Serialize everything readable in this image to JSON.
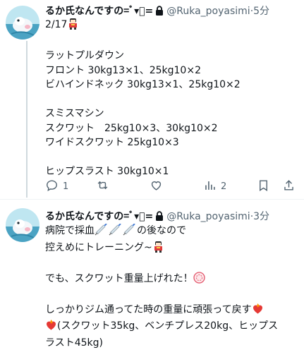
{
  "tweets": [
    {
      "author_name": "るか氏なんですの=ﾞ▾ﾞ=",
      "handle": "@Ruka_poyasimi",
      "separator": "·",
      "time": "5分",
      "body_lines": [
        "2/17",
        "",
        "ラットプルダウン",
        "フロント 30kg13×1、25kg10×2",
        "ビハインドネック 30kg13×1、25kg10×2",
        "",
        "スミスマシン",
        "スクワット　25kg10×3、30kg10×2",
        "ワイドスクワット 25kg10×3",
        "",
        "ヒップスラスト 30kg10×1"
      ],
      "actions": {
        "reply_count": "1",
        "repost_count": "",
        "like_count": "",
        "views_count": "2"
      }
    },
    {
      "author_name": "るか氏なんですの=ﾞ▾ﾞ=",
      "handle": "@Ruka_poyasimi",
      "separator": "·",
      "time": "3分",
      "body_lines": [
        "病院で採血",
        "控えめにトレーニング~",
        "",
        "でも、スクワット重量上げれた！",
        "",
        "しっかりジム通ってた時の重量に頑張って戻す",
        "(スクワット35kg、ベンチプレス20kg、ヒップス",
        "ラスト45kg)"
      ],
      "body_suffix": "の後なので"
    }
  ],
  "colors": {
    "text": "#0f1419",
    "secondary": "#536471",
    "thread_line": "#cfd9de",
    "fire": "#f4511e"
  },
  "icons": [
    "lock-icon",
    "reply-icon",
    "repost-icon",
    "like-icon",
    "views-icon",
    "bookmark-icon",
    "share-icon",
    "syringe-emoji",
    "mascot-emoji",
    "fire-heart-emoji",
    "fitness-stamp-emoji"
  ]
}
